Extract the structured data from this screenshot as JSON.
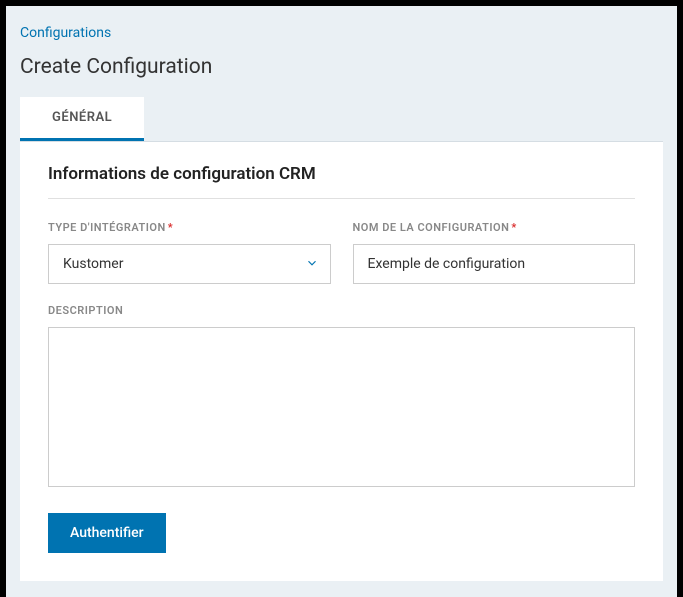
{
  "header": {
    "breadcrumb": "Configurations",
    "title": "Create Configuration"
  },
  "tabs": {
    "general": "GÉNÉRAL"
  },
  "section": {
    "heading": "Informations de configuration CRM"
  },
  "fields": {
    "integration_type": {
      "label": "TYPE D'INTÉGRATION",
      "value": "Kustomer"
    },
    "config_name": {
      "label": "NOM DE LA CONFIGURATION",
      "value": "Exemple de configuration"
    },
    "description": {
      "label": "DESCRIPTION",
      "value": ""
    }
  },
  "buttons": {
    "authenticate": "Authentifier"
  }
}
